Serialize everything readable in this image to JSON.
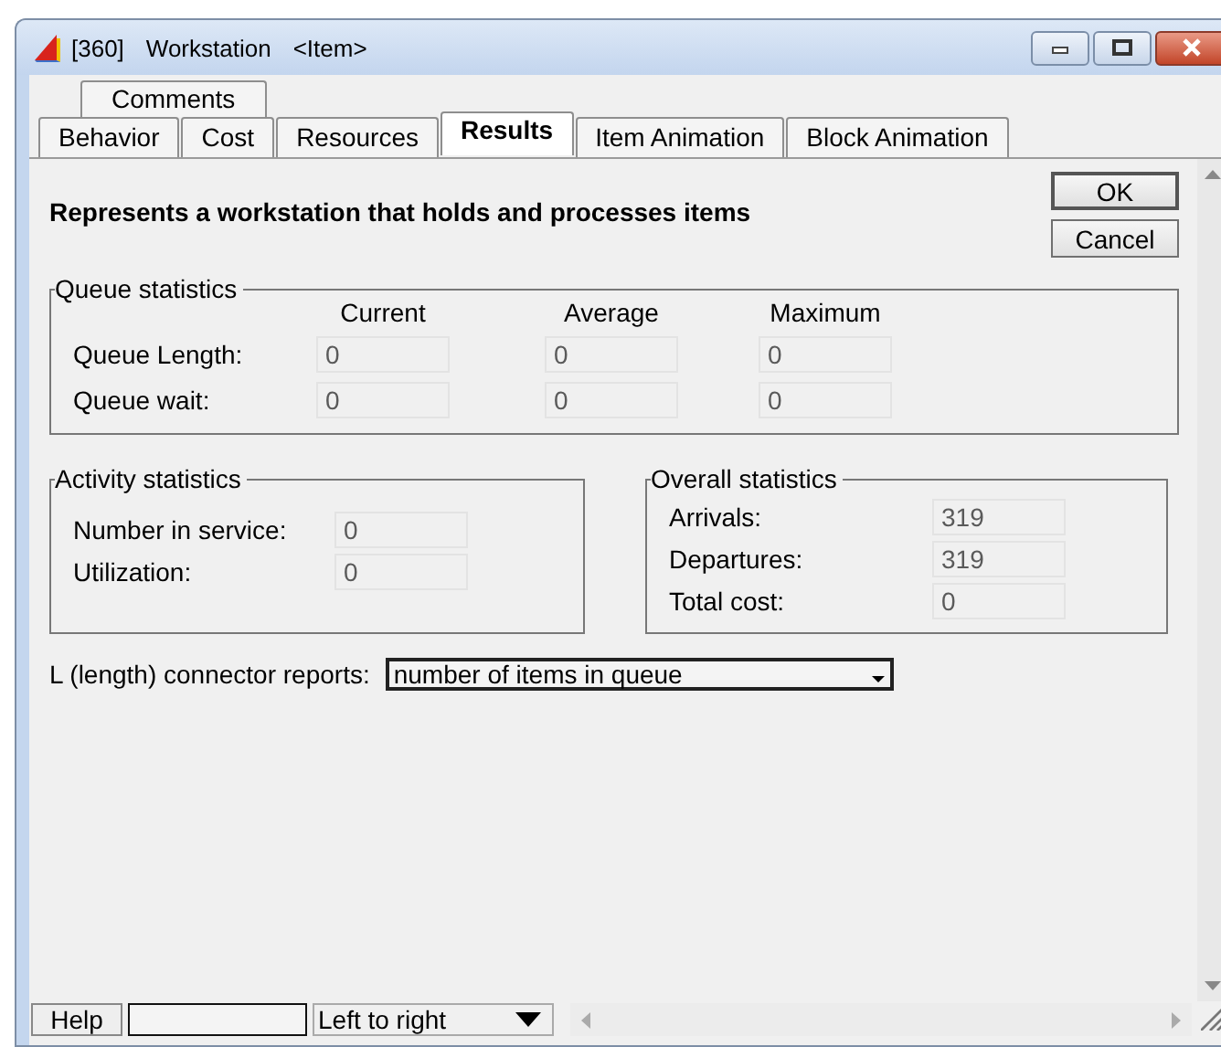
{
  "window": {
    "title_parts": [
      "[360]",
      "Workstation",
      "<Item>"
    ]
  },
  "tab_rows": [
    [
      {
        "label": "Comments",
        "selected": false
      }
    ],
    [
      {
        "label": "Behavior",
        "selected": false
      },
      {
        "label": "Cost",
        "selected": false
      },
      {
        "label": "Resources",
        "selected": false
      },
      {
        "label": "Results",
        "selected": true
      },
      {
        "label": "Item Animation",
        "selected": false
      },
      {
        "label": "Block Animation",
        "selected": false
      }
    ]
  ],
  "description": "Represents a workstation that holds and processes items",
  "buttons": [
    "OK",
    "Cancel"
  ],
  "queue_statistics": {
    "title": "Queue statistics",
    "columns": [
      "Current",
      "Average",
      "Maximum"
    ],
    "rows": [
      {
        "label": "Queue Length:",
        "values": [
          "0",
          "0",
          "0"
        ]
      },
      {
        "label": "Queue wait:",
        "values": [
          "0",
          "0",
          "0"
        ]
      }
    ]
  },
  "activity_statistics": {
    "title": "Activity statistics",
    "rows": [
      {
        "label": "Number in service:",
        "value": "0"
      },
      {
        "label": "Utilization:",
        "value": "0"
      }
    ]
  },
  "overall_statistics": {
    "title": "Overall statistics",
    "rows": [
      {
        "label": "Arrivals:",
        "value": "319"
      },
      {
        "label": "Departures:",
        "value": "319"
      },
      {
        "label": "Total cost:",
        "value": "0"
      }
    ]
  },
  "connector": {
    "label": "L (length) connector reports:",
    "value": "number of items in queue"
  },
  "bottom_bar": {
    "help_button": "Help",
    "direction": "Left to right"
  }
}
